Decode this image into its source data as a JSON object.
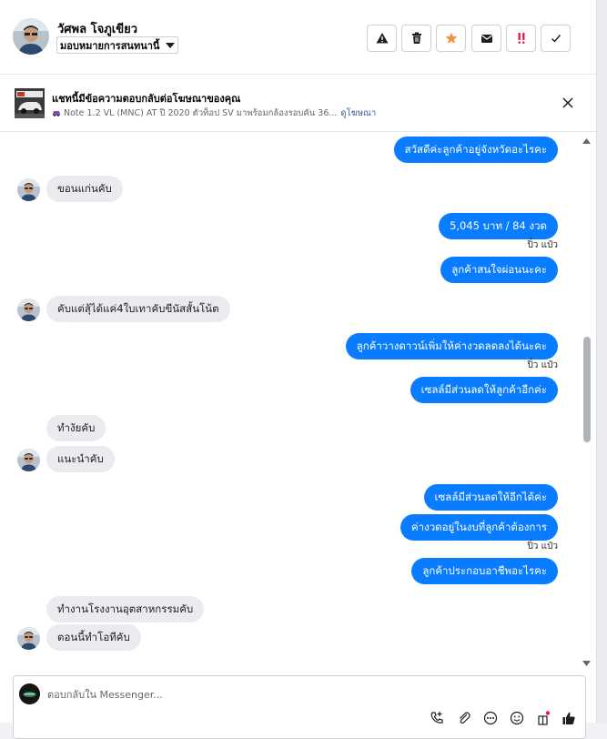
{
  "header": {
    "contact_name": "วัศพล โจภูเขียว",
    "assign_label": "มอบหมายการสนทนานี้",
    "actions": [
      {
        "name": "report-button",
        "icon": "warning-icon"
      },
      {
        "name": "delete-button",
        "icon": "trash-icon"
      },
      {
        "name": "follow-up-button",
        "icon": "star-icon"
      },
      {
        "name": "mark-unread-button",
        "icon": "envelope-icon"
      },
      {
        "name": "spam-button",
        "icon": "double-exclamation-icon"
      },
      {
        "name": "mark-done-button",
        "icon": "checkmark-icon"
      }
    ],
    "star_color": "#f7923b",
    "spam_color": "#e41e3f"
  },
  "ad_banner": {
    "title": "แชทนี้มีข้อความตอบกลับต่อโฆษณาของคุณ",
    "subtitle": "Note 1.2 VL (MNC) AT ปี 2020 ตัวท็อป SV มาพร้อมกล้องรอบคัน 36...",
    "link": "ดูโฆษณา"
  },
  "messages": [
    {
      "dir": "out",
      "text": "สวัสดีค่ะลูกค้าอยู่จังหวัดอะไรคะ"
    },
    {
      "dir": "in",
      "text": "ขอนแก่นคับ",
      "avatar": true
    },
    {
      "dir": "out",
      "text": "5,045 บาท  / 84 งวด"
    },
    {
      "dir": "seen",
      "text": "ปิ๋ว แป๋ว"
    },
    {
      "dir": "out",
      "text": "ลูกค้าสนใจผ่อนนะคะ"
    },
    {
      "dir": "in",
      "text": "คับแต่สุ้ได้แค่4ใบเทาคับขีนัสสั้นโน้ต",
      "avatar": true
    },
    {
      "dir": "out",
      "text": "ลูกค้าวางดาวน์เพิ่มให้ค่างวดลดลงได้นะคะ"
    },
    {
      "dir": "seen",
      "text": "ปิ๋ว แป๋ว"
    },
    {
      "dir": "out",
      "text": "เซลล์มีส่วนลดให้ลูกค้าอีกค่ะ"
    },
    {
      "dir": "in",
      "text": "ทำงัยคับ",
      "avatar": false
    },
    {
      "dir": "in",
      "text": "แนะนำคับ",
      "avatar": true
    },
    {
      "dir": "out",
      "text": "เซลล์มีส่วนลดให้อีกได้ค่ะ"
    },
    {
      "dir": "out",
      "text": "ค่างวดอยู่ในงบที่ลูกค้าต้องการ"
    },
    {
      "dir": "seen",
      "text": "ปิ๋ว แป๋ว"
    },
    {
      "dir": "out",
      "text": "ลูกค้าประกอบอาชีพอะไรคะ"
    },
    {
      "dir": "in",
      "text": "ทำงานโรงงานอุตสาหกรรมคับ",
      "avatar": false
    },
    {
      "dir": "in",
      "text": "ตอนนี้ทำโอทีคับ",
      "avatar": true
    }
  ],
  "composer": {
    "placeholder": "ตอบกลับใน Messenger...",
    "icons": [
      "phone-plus-icon",
      "paperclip-icon",
      "more-icon",
      "emoji-icon",
      "gift-icon",
      "like-icon"
    ]
  },
  "colors": {
    "outgoing_bubble": "#0a7cff",
    "incoming_bubble": "#e9ebee",
    "link": "#385898"
  }
}
